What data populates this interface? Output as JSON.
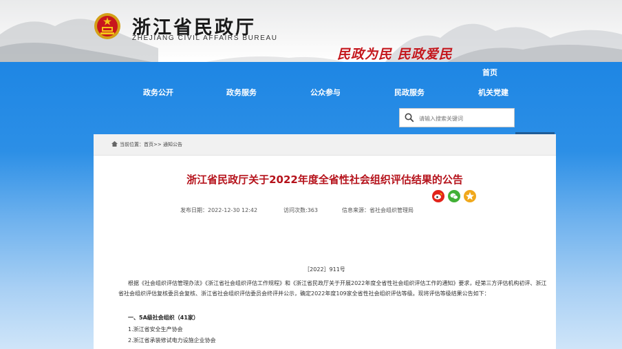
{
  "header": {
    "title": "浙江省民政厅",
    "subtitle": "ZHEJIANG CIVIL AFFAIRS BUREAU",
    "slogan": "民政为民  民政爱民",
    "emblem_icon": "national-emblem-icon"
  },
  "nav": {
    "home": "首页",
    "items": [
      "政务公开",
      "政务服务",
      "公众参与",
      "民政服务",
      "机关党建"
    ]
  },
  "search": {
    "placeholder": "请输入搜索关键词",
    "button": "搜 索"
  },
  "breadcrumb": "当前位置：首页>> 通知公告",
  "article": {
    "title": "浙江省民政厅关于2022年度全省性社会组织评估结果的公告",
    "publish_date": "发布日期：2022-12-30 12:42",
    "views": "访问次数:363",
    "source": "信息来源：省社会组织管理局",
    "doc_number": "［2022］911号",
    "body": "根据《社会组织评估管理办法》《浙江省社会组织评估工作规程》和《浙江省民政厅关于开展2022年度全省性社会组织评估工作的通知》要求，经第三方评估机构初评、浙江省社会组织评估复核委员会复核、浙江省社会组织评估委员会终评并公示，确定2022年度109家全省性社会组织评估等级。现将评估等级结果公告如下：",
    "section_heading": "一、5A级社会组织（41家）",
    "items": [
      "1.浙江省安全生产协会",
      "2.浙江省承装修试电力设施企业协会"
    ]
  },
  "share": [
    "weibo-icon",
    "wechat-icon",
    "qzone-icon"
  ],
  "colors": {
    "nav_blue": "#1e86e4",
    "title_red": "#b5121b",
    "slogan_red": "#c4161c",
    "search_button": "#1f5c97"
  }
}
